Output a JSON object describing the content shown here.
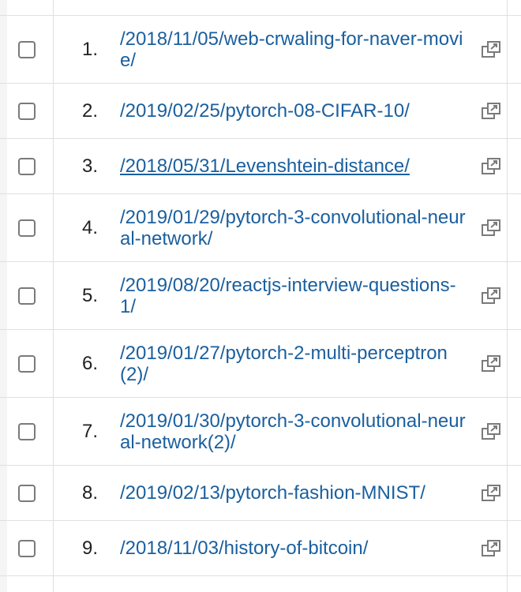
{
  "rows": [
    {
      "num": "1.",
      "path": "/2018/11/05/web-crwaling-for-naver-movie/",
      "underline": false
    },
    {
      "num": "2.",
      "path": "/2019/02/25/pytorch-08-CIFAR-10/",
      "underline": false
    },
    {
      "num": "3.",
      "path": "/2018/05/31/Levenshtein-distance/",
      "underline": true
    },
    {
      "num": "4.",
      "path": "/2019/01/29/pytorch-3-convolutional-neural-network/",
      "underline": false
    },
    {
      "num": "5.",
      "path": "/2019/08/20/reactjs-interview-questions-1/",
      "underline": false
    },
    {
      "num": "6.",
      "path": "/2019/01/27/pytorch-2-multi-perceptron(2)/",
      "underline": false
    },
    {
      "num": "7.",
      "path": "/2019/01/30/pytorch-3-convolutional-neural-network(2)/",
      "underline": false
    },
    {
      "num": "8.",
      "path": "/2019/02/13/pytorch-fashion-MNIST/",
      "underline": false
    },
    {
      "num": "9.",
      "path": "/2018/11/03/history-of-bitcoin/",
      "underline": false
    }
  ],
  "icons": {
    "checkbox": "checkbox-unchecked",
    "open": "open-in-new-window-icon"
  },
  "colors": {
    "link": "#1a5f9e",
    "text": "#212121",
    "border": "#e0e0e0"
  }
}
